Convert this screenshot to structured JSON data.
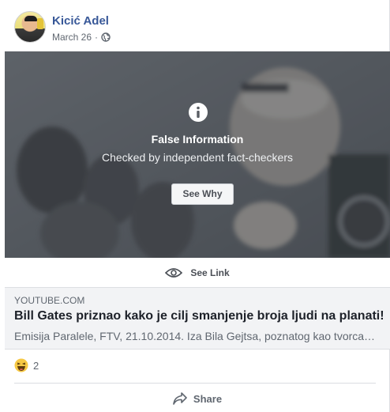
{
  "post": {
    "author": "Kicić Adel",
    "date": "March 26",
    "separator": "·",
    "privacy_icon": "globe-icon"
  },
  "fact_check": {
    "icon": "info-icon",
    "title": "False Information",
    "subtitle": "Checked by independent fact-checkers",
    "button_label": "See Why"
  },
  "see_link": {
    "icon": "eye-icon",
    "label": "See Link"
  },
  "link_preview": {
    "domain": "YOUTUBE.COM",
    "title": "Bill Gates priznao kako je cilj smanjenje broja ljudi na planati!",
    "description": "Emisija Paralele, FTV, 21.10.2014. Iza Bila Gejtsa, poznatog kao tvorca…"
  },
  "reactions": {
    "icon": "haha-icon",
    "count": "2"
  },
  "actions": {
    "share_icon": "share-icon",
    "share_label": "Share"
  },
  "colors": {
    "author_link": "#385898",
    "muted_text": "#606770",
    "overlay": "#464a50",
    "preview_bg": "#f2f3f5"
  }
}
